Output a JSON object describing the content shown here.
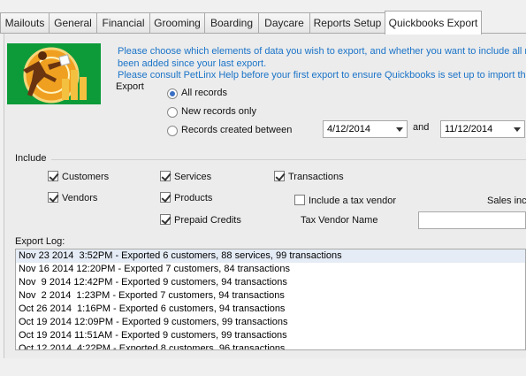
{
  "tabs": [
    {
      "label": "Mailouts",
      "active": false
    },
    {
      "label": "General",
      "active": false
    },
    {
      "label": "Financial",
      "active": false
    },
    {
      "label": "Grooming",
      "active": false
    },
    {
      "label": "Boarding",
      "active": false
    },
    {
      "label": "Daycare",
      "active": false
    },
    {
      "label": "Reports Setup",
      "active": false
    },
    {
      "label": "Quickbooks Export",
      "active": true
    }
  ],
  "info": {
    "line1": "Please choose which elements of data you wish to export, and whether you want to include all r",
    "line2": "been added since your last export.",
    "line3": "Please consult PetLinx Help before your first export to ensure Quickbooks is set up to import the"
  },
  "export": {
    "heading": "Export",
    "options": [
      {
        "label": "All records",
        "selected": true
      },
      {
        "label": "New records only",
        "selected": false
      },
      {
        "label": "Records created between",
        "selected": false
      }
    ],
    "date_from": "4/12/2014",
    "and_label": "and",
    "date_to": "11/12/2014"
  },
  "include": {
    "heading": "Include",
    "customers": {
      "label": "Customers",
      "checked": true
    },
    "vendors": {
      "label": "Vendors",
      "checked": true
    },
    "services": {
      "label": "Services",
      "checked": true
    },
    "products": {
      "label": "Products",
      "checked": true
    },
    "prepaid": {
      "label": "Prepaid Credits",
      "checked": true
    },
    "transactions": {
      "label": "Transactions",
      "checked": true
    },
    "tax_vendor": {
      "label": "Include a tax vendor",
      "checked": false
    },
    "tax_vendor_name_label": "Tax Vendor Name",
    "tax_vendor_name_value": "",
    "sales_label": "Sales inco"
  },
  "log": {
    "heading": "Export Log:",
    "rows": [
      "Nov 23 2014  3:52PM - Exported 6 customers, 88 services, 99 transactions",
      "Nov 16 2014 12:20PM - Exported 7 customers, 84 transactions",
      "Nov  9 2014 12:42PM - Exported 9 customers, 94 transactions",
      "Nov  2 2014  1:23PM - Exported 7 customers, 94 transactions",
      "Oct 26 2014  1:16PM - Exported 6 customers, 94 transactions",
      "Oct 19 2014 12:09PM - Exported 9 customers, 99 transactions",
      "Oct 19 2014 11:51AM - Exported 9 customers, 99 transactions",
      "Oct 12 2014  4:22PM - Exported 8 customers, 96 transactions"
    ]
  },
  "colors": {
    "accent": "#1a73c8",
    "logo_bg": "#0d9b3a"
  }
}
